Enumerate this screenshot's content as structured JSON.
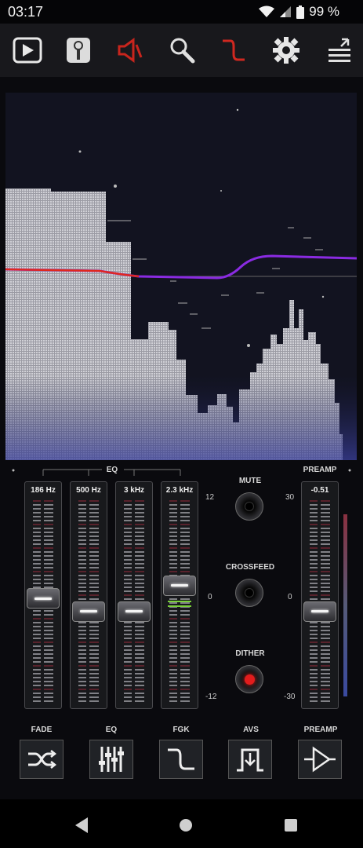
{
  "status": {
    "time": "03:17",
    "battery": "99 %"
  },
  "toolbar": {
    "icons": [
      "play-icon",
      "tag-icon",
      "speaker-icon",
      "search-icon",
      "curve-icon",
      "gear-icon",
      "menu-icon"
    ]
  },
  "eq": {
    "title": "EQ",
    "bands": [
      {
        "label": "186 Hz",
        "level": 0.52
      },
      {
        "label": "500 Hz",
        "level": 0.45
      },
      {
        "label": "3 kHz",
        "level": 0.45
      },
      {
        "label": "2.3 kHz",
        "level": 0.59
      }
    ],
    "scale": {
      "top": "12",
      "mid": "0",
      "bottom": "-12"
    }
  },
  "controls": {
    "mute": "MUTE",
    "crossfeed": "CROSSFEED",
    "dither": "DITHER"
  },
  "preamp": {
    "title": "PREAMP",
    "value": "-0.51",
    "level": 0.45,
    "scale": {
      "top": "30",
      "mid": "0",
      "bottom": "-30"
    }
  },
  "bottom_buttons": [
    {
      "label": "FADE",
      "icon": "shuffle-icon"
    },
    {
      "label": "EQ",
      "icon": "eq-sliders-icon"
    },
    {
      "label": "FGK",
      "icon": "curve-icon"
    },
    {
      "label": "AVS",
      "icon": "avs-icon"
    },
    {
      "label": "PREAMP",
      "icon": "amplifier-icon"
    }
  ],
  "colors": {
    "accent_red": "#e0281e",
    "curve_purple": "#8a2be2",
    "spectrum": "#c9c9d0"
  }
}
